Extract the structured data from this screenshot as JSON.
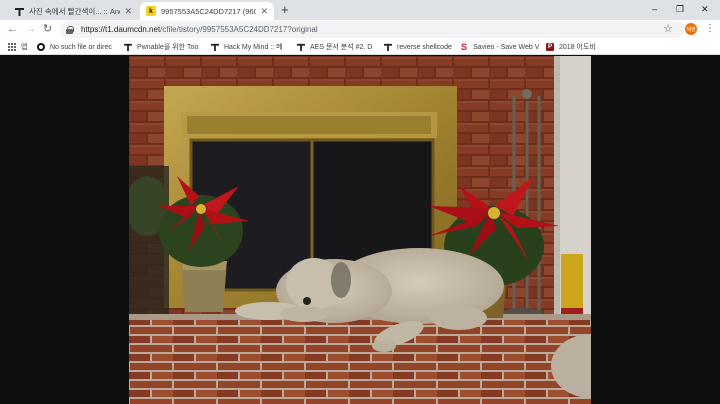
{
  "tabs": [
    {
      "title": "사진 속에서 빨간색이... :: Anony",
      "favicon": "tistory-icon",
      "active": false
    },
    {
      "title": "9957553A5C24DD7217 (960×7",
      "favicon": "k",
      "active": true
    }
  ],
  "window_controls": {
    "minimize": "–",
    "restore": "❐",
    "close": "✕"
  },
  "toolbar": {
    "url_host": "https://t1.daumcdn.net",
    "url_path": "/cfile/tistory/9957553A5C24DD7217?original",
    "profile_label": "재현"
  },
  "bookmarks": [
    {
      "label": "앱",
      "icon": "apps-icon"
    },
    {
      "label": "No such file or direc",
      "icon": "github-icon"
    },
    {
      "label": "Pwnable을 위한 Too",
      "icon": "tistory-icon"
    },
    {
      "label": "Hack My Mind :: 메",
      "icon": "tistory-icon"
    },
    {
      "label": "AES 문서 분석 #2. D",
      "icon": "tistory-icon"
    },
    {
      "label": "reverse shellcode",
      "icon": "tistory-icon"
    },
    {
      "label": "Savieo - Save Web V",
      "icon": "savieo-icon"
    },
    {
      "label": "2018 어도비",
      "icon": "pdf-icon"
    }
  ],
  "colors": {
    "tab_strip": "#dee1e6",
    "viewer_bg": "#0e0e0e",
    "profile": "#e8710a",
    "savieo": "#e0102b",
    "pdf": "#8b1a1a"
  }
}
